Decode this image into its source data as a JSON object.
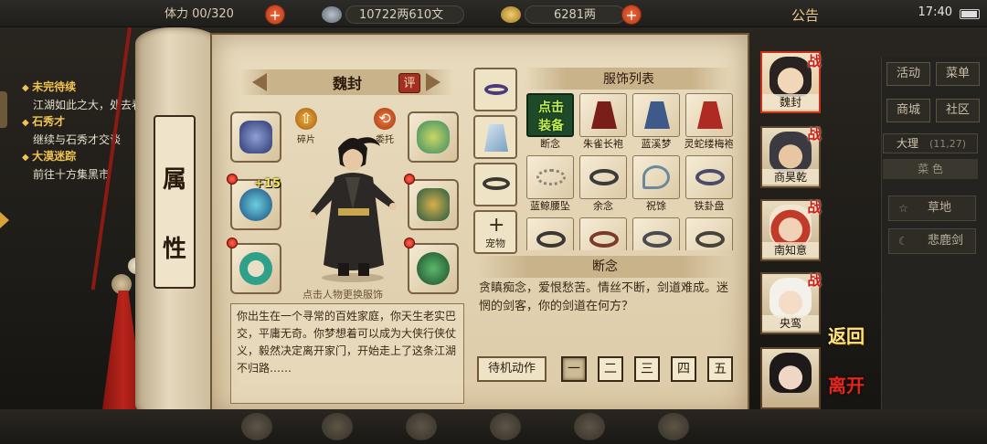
{
  "topbar": {
    "stamina": "00/320",
    "money_silver": "10722两610文",
    "money_gold": "6281两",
    "notice_label": "公告",
    "time": "17:40"
  },
  "quests": [
    {
      "title": "未完待续",
      "desc": "江湖如此之大，处去看看"
    },
    {
      "title": "石秀才",
      "desc": "继续与石秀才交谈"
    },
    {
      "title": "大漠迷踪",
      "desc": "前往十方集黑市"
    }
  ],
  "right_menu": {
    "buttons": [
      "活动",
      "菜单",
      "商城",
      "社区"
    ],
    "location": "大理",
    "location_coords": "(11,27)",
    "map_label": "菜 色",
    "places": [
      "草地",
      "悲鹿剑"
    ]
  },
  "scroll": {
    "label_chars": [
      "属",
      "性"
    ]
  },
  "character": {
    "name": "魏封",
    "eval_label": "评",
    "actions": [
      {
        "label": "碎片",
        "icon": "arrow-up-icon"
      },
      {
        "label": "委托",
        "icon": "swap-icon"
      }
    ],
    "equip_plus": "+15",
    "hint": "点击人物更换服饰",
    "bio": "你出生在一个寻常的百姓家庭，你天生老实巴交，平庸无奇。你梦想着可以成为大侠行侠仗义，毅然决定离开家门，开始走上了这条江湖不归路……"
  },
  "tabs": {
    "pet_label": "宠物"
  },
  "outfits": {
    "title": "服饰列表",
    "selected_label_line1": "点击",
    "selected_label_line2": "装备",
    "items": [
      {
        "name": "断念",
        "color": "#2e2a26"
      },
      {
        "name": "朱雀长袍",
        "color": "#7a1e1a"
      },
      {
        "name": "蓝溪梦",
        "color": "#3d5a8a"
      },
      {
        "name": "灵蛇缕梅袍",
        "color": "#b02a24"
      },
      {
        "name": "蓝鲸腰坠",
        "color": "#b9b4a8"
      },
      {
        "name": "余念",
        "color": "#3a3a3a"
      },
      {
        "name": "祝馀",
        "color": "#6a8a9a"
      },
      {
        "name": "铁卦盘",
        "color": "#4a4a6a"
      },
      {
        "name": "",
        "color": "#3a3632"
      },
      {
        "name": "",
        "color": "#7a3a2a"
      },
      {
        "name": "",
        "color": "#4a4a52"
      },
      {
        "name": "",
        "color": "#44423a"
      }
    ]
  },
  "description": {
    "title": "断念",
    "text": "贪瞋痴念，爱恨愁苦。情丝不断，剑道难成。迷惘的剑客，你的剑道在何方？"
  },
  "actions": {
    "idle_label": "待机动作",
    "numbers": [
      "一",
      "二",
      "三",
      "四",
      "五"
    ]
  },
  "roster": [
    {
      "name": "魏封",
      "battle": "战"
    },
    {
      "name": "商昊乾",
      "battle": "战"
    },
    {
      "name": "南知意",
      "battle": "战"
    },
    {
      "name": "央鸾",
      "battle": "战"
    },
    {
      "name": "",
      "battle": ""
    }
  ],
  "nav": {
    "return_label": "返回",
    "leave_label": "离开"
  }
}
